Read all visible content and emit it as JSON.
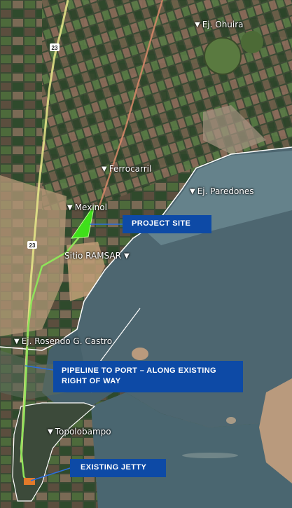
{
  "places": {
    "ohuira": "Ej. Ohuira",
    "ferrocarril": "Ferrocarril",
    "paredones": "Ej. Paredones",
    "mexinol": "Mexinol",
    "ramsar": "Sitio RAMSAR",
    "rosendo": "Ej. Rosendo G. Castro",
    "topolobampo": "Topolobampo"
  },
  "highway_shield": "23",
  "callouts": {
    "project_site": "PROJECT SITE",
    "pipeline": "PIPELINE TO PORT – ALONG EXISTING RIGHT OF WAY",
    "jetty": "EXISTING JETTY"
  },
  "colors": {
    "callout_bg": "#0d4aa6",
    "project_site": "#3fe01a",
    "pipeline": "#8fe35a",
    "highway": "#e9e98a",
    "railroad": "#d98a6a",
    "water": "#4d6670"
  },
  "icons": {
    "place_marker": "white-down-arrow-icon"
  }
}
